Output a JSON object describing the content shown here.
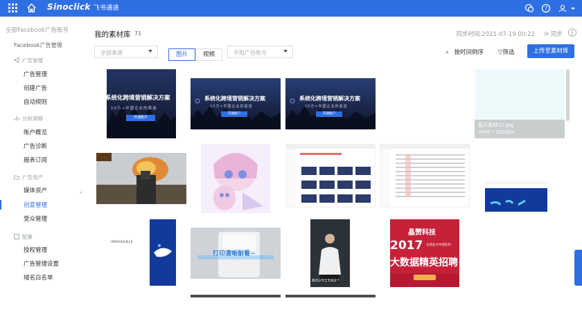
{
  "topbar": {
    "brand": "Sinoclick",
    "brand_cn": "飞书通途",
    "colors": {
      "primary": "#2f6fe4"
    }
  },
  "sidebar": {
    "account_selector": "全部Facebook广告账号",
    "top_item": "Facebook广告管理",
    "sections": [
      {
        "title": "广告管理",
        "items": [
          "广告管理",
          "创建广告",
          "自动规则"
        ]
      },
      {
        "title": "分析洞察",
        "items": [
          "账户概览",
          "广告诊断",
          "报表订阅"
        ]
      },
      {
        "title": "广告资产",
        "items": [
          "媒体资产",
          "创意管理",
          "受众管理"
        ]
      },
      {
        "title": "配置",
        "items": [
          "授权管理",
          "广告管理设置",
          "域名白名单"
        ]
      }
    ],
    "active_item": "创意管理"
  },
  "header": {
    "title": "我的素材库",
    "count": "71",
    "sync_time": "同步时间:2021-07-19 00:22",
    "sync_label": "同步"
  },
  "filters": {
    "source_select": "全部来源",
    "media_tabs": [
      "图片",
      "视频"
    ],
    "active_media_tab": "图片",
    "ad_account_select": "不限广告账号",
    "sort_label": "按时间倒序",
    "filter_label": "筛选",
    "upload_label": "上传至素材库"
  },
  "assets": [
    {
      "kind": "banner",
      "text": "系统化跨境营销解决方案",
      "sub": "10万+中国企业的首选",
      "cta": "开通账户"
    },
    {
      "kind": "banner",
      "text": "系统化跨境营销解决方案",
      "sub": "10万+中国企业的首选",
      "cta": "开通账户"
    },
    {
      "kind": "banner",
      "text": "系统化跨境营销解决方案",
      "sub": "10万+中国企业的首选",
      "cta": "开通账户"
    },
    {
      "kind": "blank",
      "caption_name": "蓝天素材(1).jpg",
      "caption_size": "3000 * 2003px"
    },
    {
      "kind": "game"
    },
    {
      "kind": "anime"
    },
    {
      "kind": "screenshot"
    },
    {
      "kind": "screenshot"
    },
    {
      "kind": "whale"
    },
    {
      "kind": "impossible",
      "text": "IMPOSSIBLE"
    },
    {
      "kind": "printer",
      "text": "打印清晰耐看~"
    },
    {
      "kind": "speaker",
      "text": "我可以完全无视这个"
    },
    {
      "kind": "promo",
      "text": "晶赞科技",
      "year": "2017",
      "sub": "大数据精英招聘",
      "tag": "与创业大牛团队约"
    }
  ]
}
